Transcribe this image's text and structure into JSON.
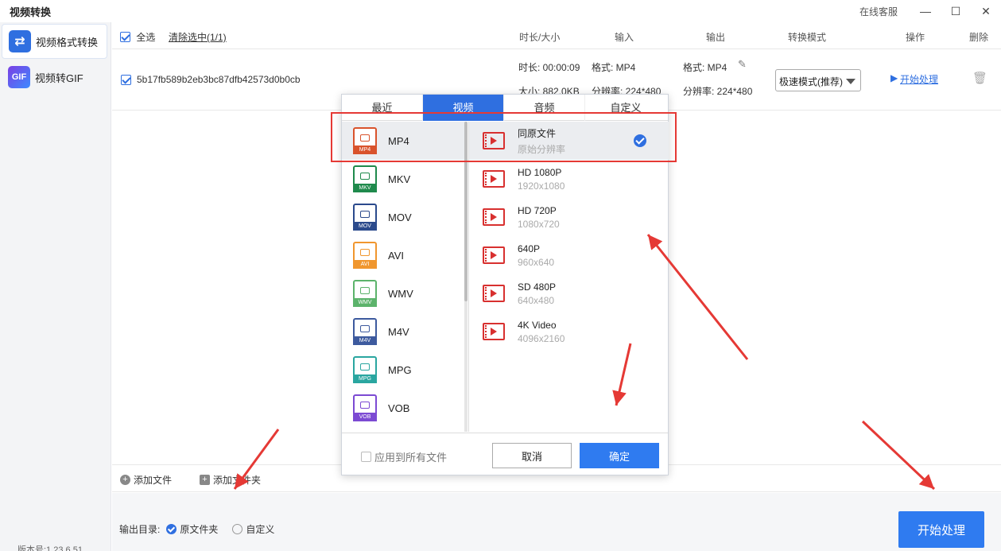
{
  "app": {
    "title": "视频转换",
    "online_service": "在线客服"
  },
  "sidebar": {
    "items": [
      {
        "label": "视频格式转换",
        "icon": "convert-arrows-icon",
        "active": true
      },
      {
        "label": "视频转GIF",
        "icon": "gif-icon",
        "active": false
      }
    ],
    "version": "版本号:1.23.6.51"
  },
  "list_header": {
    "select_all": "全选",
    "clear_selected": "清除选中(1/1)",
    "col_duration": "时长/大小",
    "col_input": "输入",
    "col_output": "输出",
    "col_mode": "转换模式",
    "col_action": "操作",
    "col_delete": "删除"
  },
  "file": {
    "name": "5b17fb589b2eb3bc87dfb42573d0b0cb",
    "duration": "时长: 00:00:09",
    "size": "大小: 882.0KB",
    "input_format": "格式: MP4",
    "input_resolution": "分辨率: 224*480",
    "output_format": "格式: MP4",
    "output_resolution": "分辨率: 224*480",
    "mode": "极速模式(推荐)",
    "action": "开始处理"
  },
  "bottom": {
    "add_file": "添加文件",
    "add_folder": "添加文件夹",
    "output_dir_label": "输出目录:",
    "opt_original": "原文件夹",
    "opt_custom": "自定义",
    "start": "开始处理"
  },
  "popup": {
    "tabs": [
      {
        "label": "最近",
        "active": false
      },
      {
        "label": "视频",
        "active": true
      },
      {
        "label": "音频",
        "active": false
      },
      {
        "label": "自定义",
        "active": false
      }
    ],
    "formats": [
      {
        "label": "MP4",
        "color": "#d9532c",
        "active": true
      },
      {
        "label": "MKV",
        "color": "#1f8a4c",
        "active": false
      },
      {
        "label": "MOV",
        "color": "#2b4a8c",
        "active": false
      },
      {
        "label": "AVI",
        "color": "#f0962e",
        "active": false
      },
      {
        "label": "WMV",
        "color": "#5cb36b",
        "active": false
      },
      {
        "label": "M4V",
        "color": "#3d5a9e",
        "active": false
      },
      {
        "label": "MPG",
        "color": "#2aa6a0",
        "active": false
      },
      {
        "label": "VOB",
        "color": "#7c4ad3",
        "active": false
      }
    ],
    "resolutions": [
      {
        "name": "同原文件",
        "sub": "原始分辨率",
        "active": true
      },
      {
        "name": "HD 1080P",
        "sub": "1920x1080",
        "active": false
      },
      {
        "name": "HD 720P",
        "sub": "1080x720",
        "active": false
      },
      {
        "name": "640P",
        "sub": "960x640",
        "active": false
      },
      {
        "name": "SD 480P",
        "sub": "640x480",
        "active": false
      },
      {
        "name": "4K Video",
        "sub": "4096x2160",
        "active": false
      }
    ],
    "apply_all": "应用到所有文件",
    "cancel": "取消",
    "ok": "确定"
  },
  "colors": {
    "accent": "#2f6fe0",
    "annotation": "#e53935"
  }
}
